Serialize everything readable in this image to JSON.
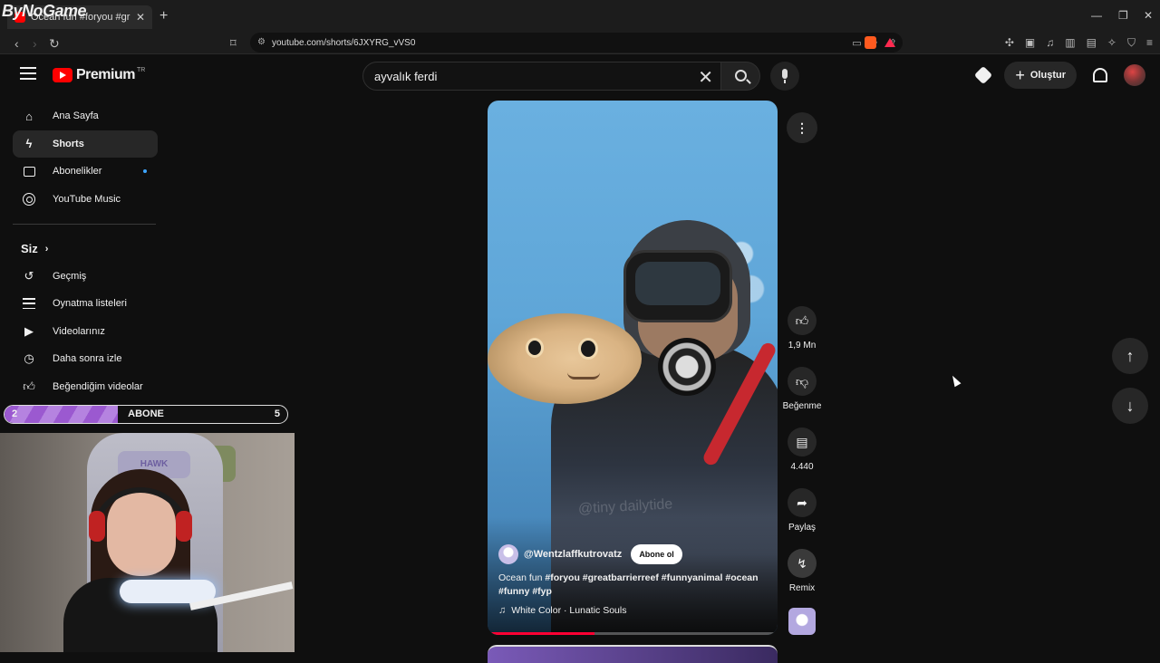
{
  "browser": {
    "tab_title": "Ocean fun #foryou #greatbarrierreef",
    "url": "youtube.com/shorts/6JXYRG_vVS0",
    "overlay_watermark": "ByNoGame"
  },
  "header": {
    "logo_text": "Premium",
    "region": "TR",
    "search_value": "ayvalık ferdi",
    "create_label": "Oluştur"
  },
  "sidebar": {
    "items": [
      {
        "label": "Ana Sayfa",
        "icon": "home-icon"
      },
      {
        "label": "Shorts",
        "icon": "shorts-icon",
        "active": true
      },
      {
        "label": "Abonelikler",
        "icon": "subscriptions-icon",
        "new": true
      },
      {
        "label": "YouTube Music",
        "icon": "youtube-music-icon"
      }
    ],
    "you_section": {
      "title": "Siz",
      "items": [
        {
          "label": "Geçmiş",
          "icon": "history-icon"
        },
        {
          "label": "Oynatma listeleri",
          "icon": "playlists-icon"
        },
        {
          "label": "Videolarınız",
          "icon": "your-videos-icon"
        },
        {
          "label": "Daha sonra izle",
          "icon": "watch-later-icon"
        },
        {
          "label": "Beğendiğim videolar",
          "icon": "liked-videos-icon"
        }
      ]
    }
  },
  "stream_overlay": {
    "goal_label": "ABONE",
    "current": "2",
    "goal": "5",
    "progress_fraction": 0.4,
    "chair_brand": "HAWK"
  },
  "short": {
    "channel": "@Wentzlaffkutrovatz",
    "subscribe_label": "Abone ol",
    "caption_plain": "Ocean fun",
    "caption_tags": "#foryou #greatbarrierreef #funnyanimal #ocean #funny #fyp",
    "music": "White Color · Lunatic Souls",
    "video_watermark": "@tiny dailytide",
    "progress_fraction": 0.37
  },
  "actions": {
    "likes": "1,9 Mn",
    "dislike_label": "Beğenme",
    "comments": "4.440",
    "share_label": "Paylaş",
    "remix_label": "Remix"
  },
  "colors": {
    "background": "#0f0f0f",
    "accent_red": "#ff0000",
    "chip": "#272727",
    "overlay_purple": "#9b59d0"
  }
}
